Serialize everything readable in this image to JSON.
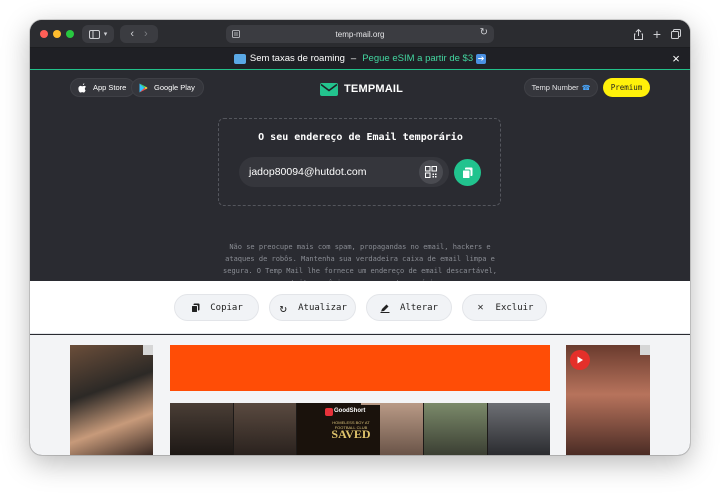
{
  "browser": {
    "url": "temp-mail.org"
  },
  "banner": {
    "text": "Sem taxas de roaming",
    "separator": "–",
    "promo": "Pegue eSIM a partir de $3",
    "close": "×"
  },
  "header": {
    "app_store": "App Store",
    "google_play": "Google Play",
    "logo_text": "TEMPMAIL",
    "temp_number": "Temp Number",
    "premium": "Premium"
  },
  "email": {
    "title": "O seu endereço de Email temporário",
    "address": "jadop80094@hutdot.com"
  },
  "description": "Não se preocupe mais com spam, propagandas no email, hackers e ataques de robôs. Mantenha sua verdadeira caixa de email limpa e segura. O Temp Mail lhe fornece um endereço de email descartável, gratuito, anônimo, seguro e temporário.",
  "actions": {
    "copy": "Copiar",
    "refresh": "Atualizar",
    "change": "Alterar",
    "delete": "Excluir"
  },
  "ads": {
    "goodshort": "GoodShort",
    "saved": "SAVED",
    "saved_sub": "HOMELESS BOY AT FOOTBALL CLUB"
  },
  "colors": {
    "accent": "#22c08a",
    "premium": "#fff10a",
    "ad_red": "#ff4d06"
  }
}
